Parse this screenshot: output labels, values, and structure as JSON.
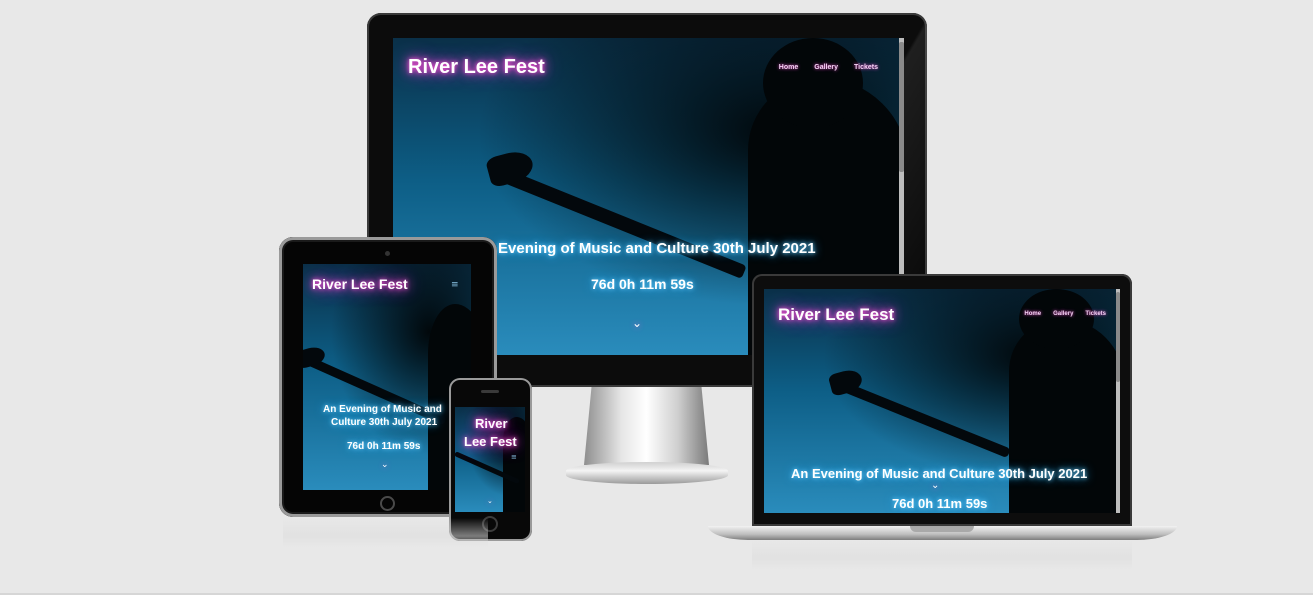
{
  "site": {
    "brand": "River Lee Fest",
    "brand_phone_line1": "River",
    "brand_phone_line2": "Lee Fest",
    "nav": [
      "Home",
      "Gallery",
      "Tickets"
    ],
    "headline_desktop": "Evening of Music and Culture 30th July 2021",
    "headline_full": "An Evening of Music and Culture 30th July 2021",
    "headline_tablet_line1": "An Evening of Music and",
    "headline_tablet_line2": "Culture 30th July 2021",
    "countdown": "76d 0h 11m 59s",
    "chevron_icon": "chevron-down-icon",
    "hamburger_icon": "hamburger-menu-icon"
  },
  "colors": {
    "background": "#e8e8e8",
    "title_glow": "#ff4fd8",
    "text_glow": "#2aa7ff",
    "screen_top": "#0a3048",
    "screen_bottom": "#2a8cbc"
  }
}
